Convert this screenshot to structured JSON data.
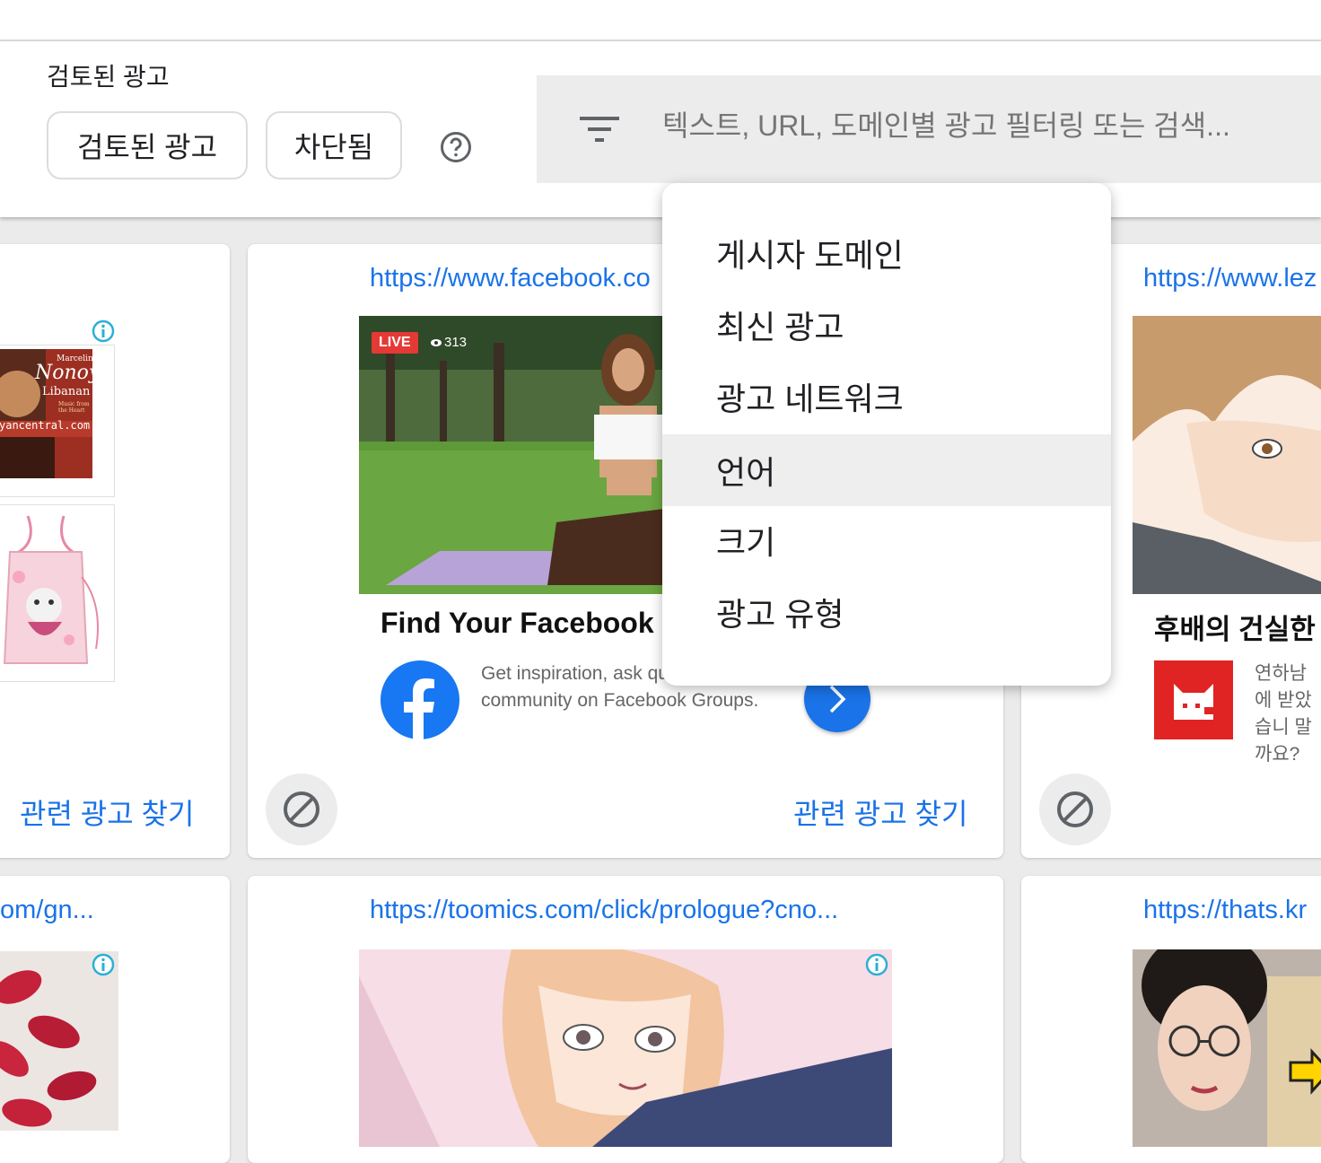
{
  "header": {
    "title": "검토된 광고",
    "chips": [
      "검토된 광고",
      "차단됨"
    ],
    "search_placeholder": "텍스트, URL, 도메인별 광고 필터링 또는 검색..."
  },
  "filter_menu": {
    "items": [
      "게시자 도메인",
      "최신 광고",
      "광고 네트워크",
      "언어",
      "크기",
      "광고 유형"
    ],
    "highlighted": "언어"
  },
  "cards": [
    {
      "related_label": "관련 광고 찾기",
      "ad_text": [
        "Marcelino",
        "Nonoy",
        "Libanan",
        "Music from the Heart",
        "yancentral.com"
      ]
    },
    {
      "url": "https://www.facebook.co",
      "live_badge": "LIVE",
      "viewer_count": "313",
      "ad_title": "Find Your Facebook C",
      "ad_description": "Get inspiration, ask qu find your community on Facebook Groups.",
      "related_label": "관련 광고 찾기"
    },
    {
      "url": "https://www.lez",
      "ad_title": "후배의 건실한",
      "ad_description": "연하남에 받았습니 말까요?"
    },
    {
      "url": "om/gn..."
    },
    {
      "url": "https://toomics.com/click/prologue?cno..."
    },
    {
      "url": "https://thats.kr"
    }
  ],
  "colors": {
    "link": "#1a73e8",
    "facebook_blue": "#1877f2",
    "live_red": "#e53935",
    "webtoon_red": "#e02424"
  }
}
